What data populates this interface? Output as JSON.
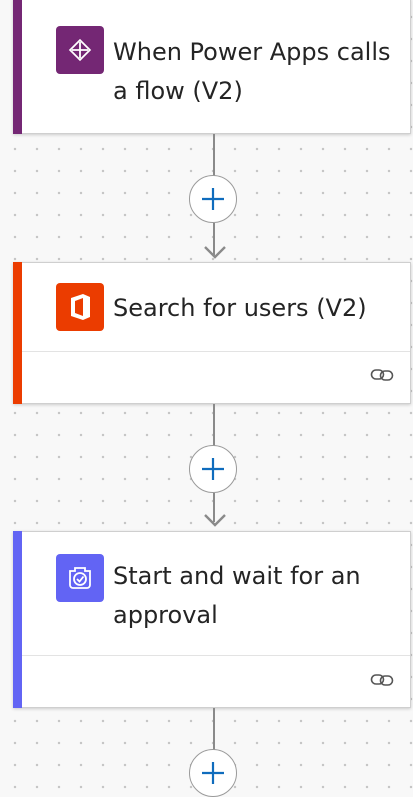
{
  "colors": {
    "power_apps": "#742774",
    "office": "#eb3c00",
    "approvals": "#6264f4",
    "connector": "#8a8a8a",
    "add_plus": "#0f6cbd"
  },
  "flow": {
    "steps": [
      {
        "title": "When Power Apps calls a flow (V2)",
        "icon": "power-apps-icon",
        "has_footer": false
      },
      {
        "title": "Search for users (V2)",
        "icon": "office-icon",
        "has_footer": true,
        "footer_icon": "link-icon"
      },
      {
        "title": "Start and wait for an approval",
        "icon": "approvals-icon",
        "has_footer": true,
        "footer_icon": "link-icon"
      }
    ],
    "add_step_icon": "plus-icon",
    "arrow_icon": "arrow-down-icon"
  }
}
